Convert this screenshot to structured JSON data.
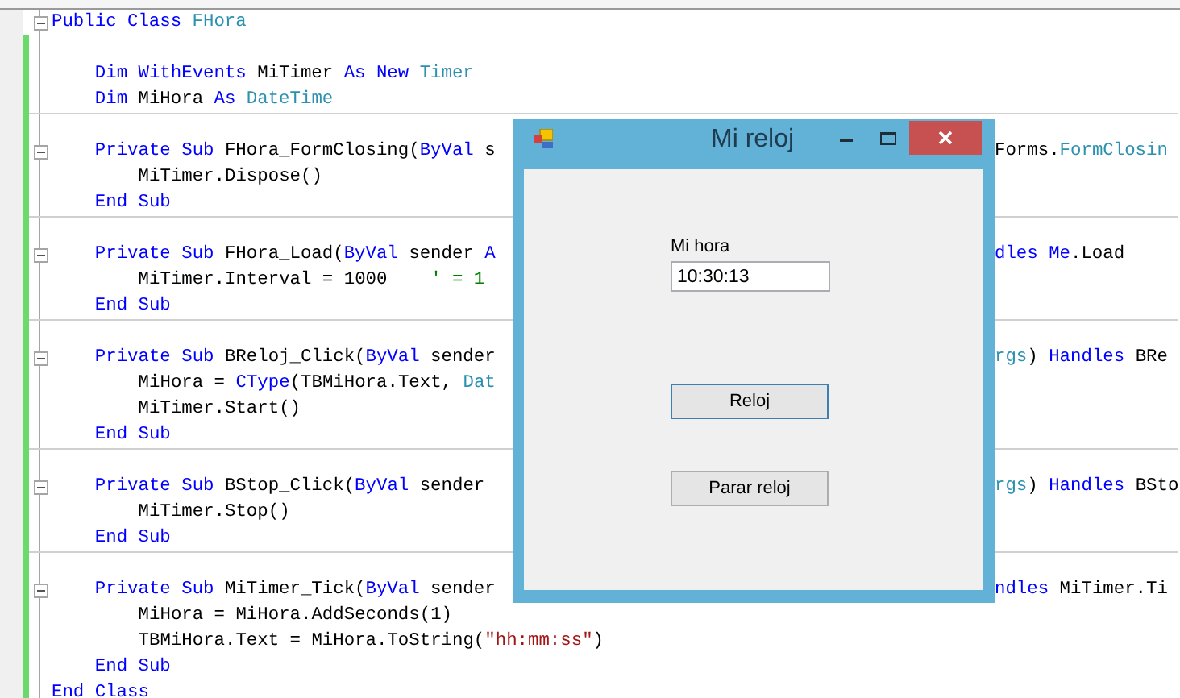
{
  "editor": {
    "code": [
      {
        "kind": "class",
        "expanded": true,
        "tokens": [
          {
            "kind": "keyword",
            "text": "Public Class "
          },
          {
            "kind": "type",
            "text": "FHora"
          }
        ],
        "children": [
          {
            "kind": "field",
            "tokens": [
              {
                "kind": "keyword",
                "text": "Dim WithEvents "
              },
              {
                "kind": "plain",
                "text": "MiTimer "
              },
              {
                "kind": "keyword",
                "text": "As New "
              },
              {
                "kind": "type",
                "text": "Timer"
              }
            ]
          },
          {
            "kind": "field",
            "tokens": [
              {
                "kind": "keyword",
                "text": "Dim "
              },
              {
                "kind": "plain",
                "text": "MiHora "
              },
              {
                "kind": "keyword",
                "text": "As "
              },
              {
                "kind": "type",
                "text": "DateTime"
              }
            ]
          },
          {
            "kind": "sub",
            "expanded": true,
            "tokens": [
              {
                "kind": "keyword",
                "text": "Private Sub "
              },
              {
                "kind": "plain",
                "text": "FHora_FormClosing("
              },
              {
                "kind": "keyword",
                "text": "ByVal"
              },
              {
                "kind": "plain",
                "text": " s"
              }
            ],
            "tail": [
              {
                "kind": "plain",
                "text": "Forms."
              },
              {
                "kind": "type",
                "text": "FormClosin"
              }
            ],
            "children": [
              {
                "kind": "statement",
                "tokens": [
                  {
                    "kind": "plain",
                    "text": "MiTimer.Dispose()"
                  }
                ]
              }
            ],
            "end": [
              {
                "kind": "keyword",
                "text": "End Sub"
              }
            ]
          },
          {
            "kind": "sub",
            "expanded": true,
            "tokens": [
              {
                "kind": "keyword",
                "text": "Private Sub "
              },
              {
                "kind": "plain",
                "text": "FHora_Load("
              },
              {
                "kind": "keyword",
                "text": "ByVal"
              },
              {
                "kind": "plain",
                "text": " sender "
              },
              {
                "kind": "keyword",
                "text": "A"
              }
            ],
            "tail": [
              {
                "kind": "keyword",
                "text": "dles Me"
              },
              {
                "kind": "plain",
                "text": ".Load"
              }
            ],
            "children": [
              {
                "kind": "statement",
                "tokens": [
                  {
                    "kind": "plain",
                    "text": "MiTimer.Interval = 1000    "
                  },
                  {
                    "kind": "comment",
                    "text": "' = 1"
                  }
                ]
              }
            ],
            "end": [
              {
                "kind": "keyword",
                "text": "End Sub"
              }
            ]
          },
          {
            "kind": "sub",
            "expanded": true,
            "tokens": [
              {
                "kind": "keyword",
                "text": "Private Sub "
              },
              {
                "kind": "plain",
                "text": "BReloj_Click("
              },
              {
                "kind": "keyword",
                "text": "ByVal"
              },
              {
                "kind": "plain",
                "text": " sender"
              }
            ],
            "tail": [
              {
                "kind": "type",
                "text": "rgs"
              },
              {
                "kind": "plain",
                "text": ") "
              },
              {
                "kind": "keyword",
                "text": "Handles "
              },
              {
                "kind": "plain",
                "text": "BRe"
              }
            ],
            "children": [
              {
                "kind": "statement",
                "tokens": [
                  {
                    "kind": "plain",
                    "text": "MiHora = "
                  },
                  {
                    "kind": "keyword",
                    "text": "CType"
                  },
                  {
                    "kind": "plain",
                    "text": "(TBMiHora.Text, "
                  },
                  {
                    "kind": "type",
                    "text": "Dat"
                  }
                ]
              },
              {
                "kind": "statement",
                "tokens": [
                  {
                    "kind": "plain",
                    "text": "MiTimer.Start()"
                  }
                ]
              }
            ],
            "end": [
              {
                "kind": "keyword",
                "text": "End Sub"
              }
            ]
          },
          {
            "kind": "sub",
            "expanded": true,
            "tokens": [
              {
                "kind": "keyword",
                "text": "Private Sub "
              },
              {
                "kind": "plain",
                "text": "BStop_Click("
              },
              {
                "kind": "keyword",
                "text": "ByVal"
              },
              {
                "kind": "plain",
                "text": " sender"
              }
            ],
            "tail": [
              {
                "kind": "type",
                "text": "rgs"
              },
              {
                "kind": "plain",
                "text": ") "
              },
              {
                "kind": "keyword",
                "text": "Handles "
              },
              {
                "kind": "plain",
                "text": "BSto"
              }
            ],
            "children": [
              {
                "kind": "statement",
                "tokens": [
                  {
                    "kind": "plain",
                    "text": "MiTimer.Stop()"
                  }
                ]
              }
            ],
            "end": [
              {
                "kind": "keyword",
                "text": "End Sub"
              }
            ]
          },
          {
            "kind": "sub",
            "expanded": true,
            "tokens": [
              {
                "kind": "keyword",
                "text": "Private Sub "
              },
              {
                "kind": "plain",
                "text": "MiTimer_Tick("
              },
              {
                "kind": "keyword",
                "text": "ByVal"
              },
              {
                "kind": "plain",
                "text": " sender"
              }
            ],
            "tail": [
              {
                "kind": "keyword",
                "text": "ndles "
              },
              {
                "kind": "plain",
                "text": "MiTimer.Ti"
              }
            ],
            "children": [
              {
                "kind": "statement",
                "tokens": [
                  {
                    "kind": "plain",
                    "text": "MiHora = MiHora.AddSeconds(1)"
                  }
                ]
              },
              {
                "kind": "statement",
                "tokens": [
                  {
                    "kind": "plain",
                    "text": "TBMiHora.Text = MiHora.ToString("
                  },
                  {
                    "kind": "string",
                    "text": "\"hh:mm:ss\""
                  },
                  {
                    "kind": "plain",
                    "text": ")"
                  }
                ]
              }
            ],
            "end": [
              {
                "kind": "keyword",
                "text": "End Sub"
              }
            ]
          }
        ],
        "end": [
          {
            "kind": "keyword",
            "text": "End Class"
          }
        ]
      }
    ]
  },
  "dialog": {
    "title": "Mi reloj",
    "label": "Mi hora",
    "time_field": {
      "value": "10:30:13"
    },
    "buttons": [
      {
        "label": "Reloj",
        "default": true
      },
      {
        "label": "Parar reloj",
        "default": false
      }
    ]
  }
}
